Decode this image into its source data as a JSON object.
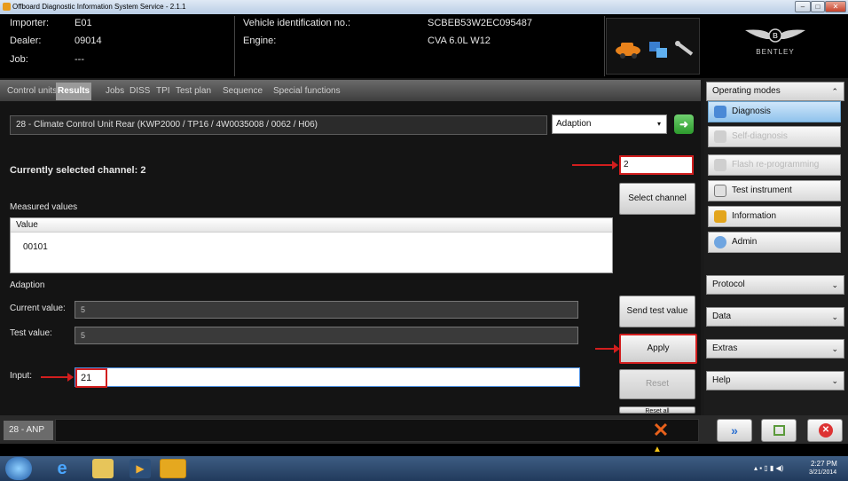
{
  "window": {
    "title": "Offboard Diagnostic Information System Service - 2.1.1"
  },
  "header": {
    "importer_label": "Importer:",
    "importer_value": "E01",
    "dealer_label": "Dealer:",
    "dealer_value": "09014",
    "job_label": "Job:",
    "job_value": "---",
    "vin_label": "Vehicle identification no.:",
    "vin_value": "SCBEB53W2EC095487",
    "engine_label": "Engine:",
    "engine_value": "CVA 6.0L W12",
    "brand": "BENTLEY"
  },
  "tabs": [
    {
      "label": "Control units"
    },
    {
      "label": "Results"
    },
    {
      "label": "Jobs"
    },
    {
      "label": "DISS"
    },
    {
      "label": "TPI"
    },
    {
      "label": "Test plan"
    },
    {
      "label": "Sequence"
    },
    {
      "label": "Special functions"
    }
  ],
  "main": {
    "control_unit": "28 - Climate Control Unit Rear  (KWP2000 / TP16 / 4W0035008  / 0062 / H06)",
    "function_select": "Adaption",
    "selected_channel_text": "Currently selected channel: 2",
    "channel_input": "2",
    "select_channel_button": "Select channel",
    "measured_values_label": "Measured values",
    "table_header": "Value",
    "table_value": "00101",
    "adaption_label": "Adaption",
    "current_value_label": "Current value:",
    "current_value": "5",
    "test_value_label": "Test value:",
    "test_value": "5",
    "input_label": "Input:",
    "input_value": "21",
    "send_test_value_button": "Send test value",
    "apply_button": "Apply",
    "reset_button": "Reset",
    "hidden_button": "Reset all"
  },
  "right_panel": {
    "operating_modes_label": "Operating modes",
    "modes": [
      {
        "label": "Diagnosis"
      },
      {
        "label": "Self-diagnosis"
      },
      {
        "label": "Flash re-programming"
      },
      {
        "label": "Test instrument"
      },
      {
        "label": "Information"
      },
      {
        "label": "Admin"
      }
    ],
    "protocol_label": "Protocol",
    "data_label": "Data",
    "extras_label": "Extras",
    "help_label": "Help"
  },
  "bottom": {
    "tab_label": "28 - ANP"
  },
  "taskbar": {
    "time": "2:27 PM",
    "date": "3/21/2014"
  },
  "colors": {
    "highlight_red": "#d21e1e",
    "accent_blue": "#90c3ec",
    "go_green": "#3aa83a"
  }
}
